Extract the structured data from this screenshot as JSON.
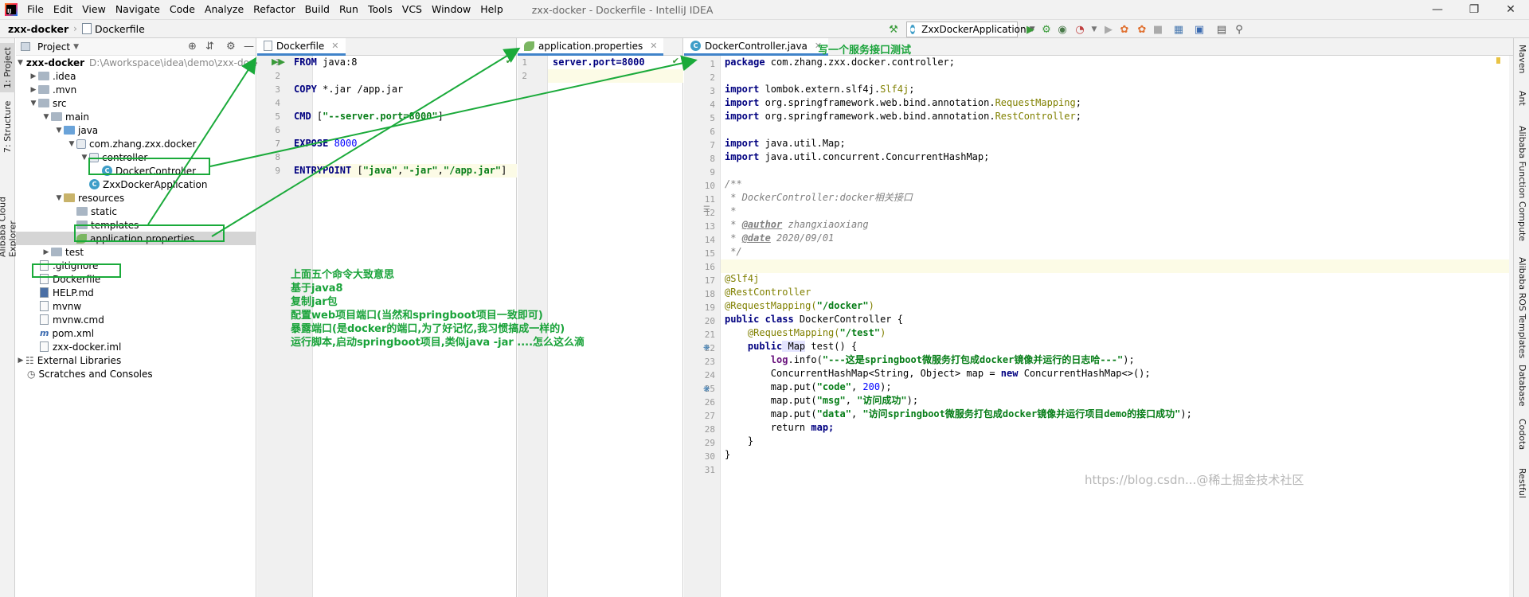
{
  "titlebar": {
    "menu": [
      "File",
      "Edit",
      "View",
      "Navigate",
      "Code",
      "Analyze",
      "Refactor",
      "Build",
      "Run",
      "Tools",
      "VCS",
      "Window",
      "Help"
    ],
    "window_title": "zxx-docker - Dockerfile - IntelliJ IDEA"
  },
  "navbar": {
    "project": "zxx-docker",
    "file": "Dockerfile",
    "run_config": "ZxxDockerApplication"
  },
  "left_stripe": {
    "project_tab": "1: Project",
    "structure_tab": "7: Structure",
    "cloud_tab": "Alibaba Cloud Explorer"
  },
  "right_stripe": {
    "tabs": [
      "Maven",
      "Ant",
      "Alibaba Function Compute",
      "Alibaba ROS Templates",
      "Database",
      "Codota",
      "Restful"
    ]
  },
  "project_panel": {
    "header": "Project",
    "tree": [
      {
        "label": "zxx-docker",
        "extra": "D:\\Aworkspace\\idea\\demo\\zxx-docker"
      },
      {
        "label": ".idea"
      },
      {
        "label": ".mvn"
      },
      {
        "label": "src"
      },
      {
        "label": "main"
      },
      {
        "label": "java"
      },
      {
        "label": "com.zhang.zxx.docker"
      },
      {
        "label": "controller"
      },
      {
        "label": "DockerController"
      },
      {
        "label": "ZxxDockerApplication"
      },
      {
        "label": "resources"
      },
      {
        "label": "static"
      },
      {
        "label": "templates"
      },
      {
        "label": "application.properties"
      },
      {
        "label": "test"
      },
      {
        "label": ".gitignore"
      },
      {
        "label": "Dockerfile"
      },
      {
        "label": "HELP.md"
      },
      {
        "label": "mvnw"
      },
      {
        "label": "mvnw.cmd"
      },
      {
        "label": "pom.xml"
      },
      {
        "label": "zxx-docker.iml"
      },
      {
        "label": "External Libraries"
      },
      {
        "label": "Scratches and Consoles"
      }
    ]
  },
  "dockerfile_editor": {
    "tab": "Dockerfile",
    "line_numbers": [
      "1",
      "2",
      "3",
      "4",
      "5",
      "6",
      "7",
      "8",
      "9"
    ],
    "lines": {
      "l1a": "FROM",
      "l1b": " java:8",
      "l3a": "COPY",
      "l3b": " *.jar /app.jar",
      "l5a": "CMD",
      "l5b": " [",
      "l5c": "\"--server.port=8000\"",
      "l5d": "]",
      "l7a": "EXPOSE",
      "l7b": " 8000",
      "l9a": "ENTRYPOINT",
      "l9b": " [",
      "l9c": "\"java\"",
      "l9d": ",",
      "l9e": "\"-jar\"",
      "l9f": ",",
      "l9g": "\"/app.jar\"",
      "l9h": "]"
    },
    "notes": [
      "上面五个命令大致意思",
      " 基于java8",
      "复制jar包",
      "配置web项目端口(当然和springboot项目一致即可)",
      "暴露端口(是docker的端口,为了好记忆,我习惯搞成一样的)",
      "运行脚本,启动springboot项目,类似java -jar ....怎么这么滴"
    ]
  },
  "properties_editor": {
    "tab": "application.properties",
    "line_numbers": [
      "1",
      "2"
    ],
    "key": "server.port",
    "eq": "=",
    "value": "8000"
  },
  "controller_editor": {
    "tab": "DockerController.java",
    "tab_note": "写一个服务接口测试",
    "line_numbers": [
      "1",
      "2",
      "3",
      "4",
      "5",
      "6",
      "7",
      "8",
      "9",
      "10",
      "11",
      "12",
      "13",
      "14",
      "15",
      "16",
      "17",
      "18",
      "19",
      "20",
      "21",
      "22",
      "23",
      "24",
      "25",
      "26",
      "27",
      "28",
      "29",
      "30",
      "31"
    ],
    "code": {
      "l1a": "package",
      "l1b": " com.zhang.zxx.docker.controller;",
      "l3a": "import",
      "l3b": " lombok.extern.slf4j.",
      "l3c": "Slf4j",
      "l3d": ";",
      "l4a": "import",
      "l4b": " org.springframework.web.bind.annotation.",
      "l4c": "RequestMapping",
      "l4d": ";",
      "l5a": "import",
      "l5b": " org.springframework.web.bind.annotation.",
      "l5c": "RestController",
      "l5d": ";",
      "l7a": "import",
      "l7b": " java.util.Map;",
      "l8a": "import",
      "l8b": " java.util.concurrent.ConcurrentHashMap;",
      "l10": "/**",
      "l11a": " * DockerController:docker",
      "l11b": "相关接口",
      "l12": " *",
      "l13a": " * ",
      "l13b": "@author",
      "l13c": " zhangxiaoxiang",
      "l14a": " * ",
      "l14b": "@date",
      "l14c": " 2020/09/01",
      "l15": " */",
      "l17": "@Slf4j",
      "l18": "@RestController",
      "l19a": "@RequestMapping(",
      "l19b": "\"/docker\"",
      "l19c": ")",
      "l20a": "public class",
      "l20b": " DockerController {",
      "l21a": "    @RequestMapping(",
      "l21b": "\"/test\"",
      "l21c": ")",
      "l22a": "    public",
      "l22b": " Map",
      " l22c": "",
      "l22d": " test() {",
      "l23a": "        log",
      ".l23b": "",
      "l23c": ".info(",
      "l23d": "\"---这是springboot微服务打包成docker镜像并运行的日志哈---\"",
      "l23e": ");",
      "l24a": "        ConcurrentHashMap<String, Object> map = ",
      "l24b": "new",
      "l24c": " ConcurrentHashMap<>();",
      "l25a": "        map.put(",
      "l25b": "\"code\"",
      "l25c": ", ",
      "l25d": "200",
      "l25e": ");",
      "l26a": "        map.put(",
      "l26b": "\"msg\"",
      "l26c": ", ",
      "l26d": "\"访问成功\"",
      "l26e": ");",
      "l27a": "        map.put(",
      "l27b": "\"data\"",
      "l27c": ", ",
      "l27d": "\"访问springboot微服务打包成docker镜像并运行项目demo的接口成功\"",
      "l27e": ");",
      "l28a": "        return",
      "l28b": " map;",
      "l29": "    }",
      "l30": "}"
    }
  },
  "watermark": "https://blog.csdn...@稀土掘金技术社区",
  "colors": {
    "annotation_green": "#1aaa3a",
    "accent_tab": "#4083c9"
  }
}
